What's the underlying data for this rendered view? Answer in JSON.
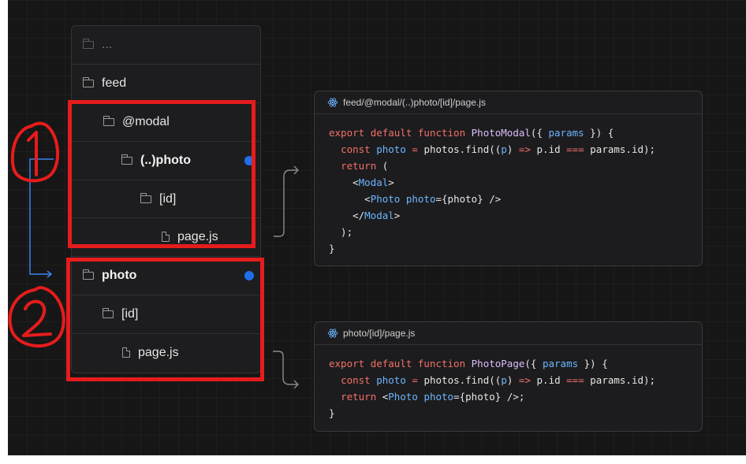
{
  "tree": {
    "rows": [
      {
        "label": "...",
        "type": "folder"
      },
      {
        "label": "feed",
        "type": "folder"
      },
      {
        "label": "@modal",
        "type": "folder"
      },
      {
        "label": "(..)photo",
        "type": "folder"
      },
      {
        "label": "[id]",
        "type": "folder"
      },
      {
        "label": "page.js",
        "type": "file"
      },
      {
        "label": "photo",
        "type": "folder"
      },
      {
        "label": "[id]",
        "type": "folder"
      },
      {
        "label": "page.js",
        "type": "file"
      }
    ]
  },
  "annotations": {
    "one": "1",
    "two": "2"
  },
  "panel1": {
    "path": "feed/@modal/(..)photo/[id]/page.js",
    "code": {
      "export": "export",
      "default": "default",
      "function": "function",
      "name": "PhotoModal",
      "params": "params",
      "const": "const",
      "photo": "photo",
      "photos_find": "photos.find",
      "p": "p",
      "arrow": "=>",
      "pid": "p.id",
      "eq": "===",
      "paramsid": "params.id",
      "return": "return",
      "Modal": "Modal",
      "Photo": "Photo",
      "photoAttr": "photo"
    }
  },
  "panel2": {
    "path": "photo/[id]/page.js",
    "code": {
      "name": "PhotoPage"
    }
  },
  "colors": {
    "accent_dot": "#1f6feb",
    "annotation_red": "#e61c1c",
    "connector_blue": "#3b82f6"
  }
}
